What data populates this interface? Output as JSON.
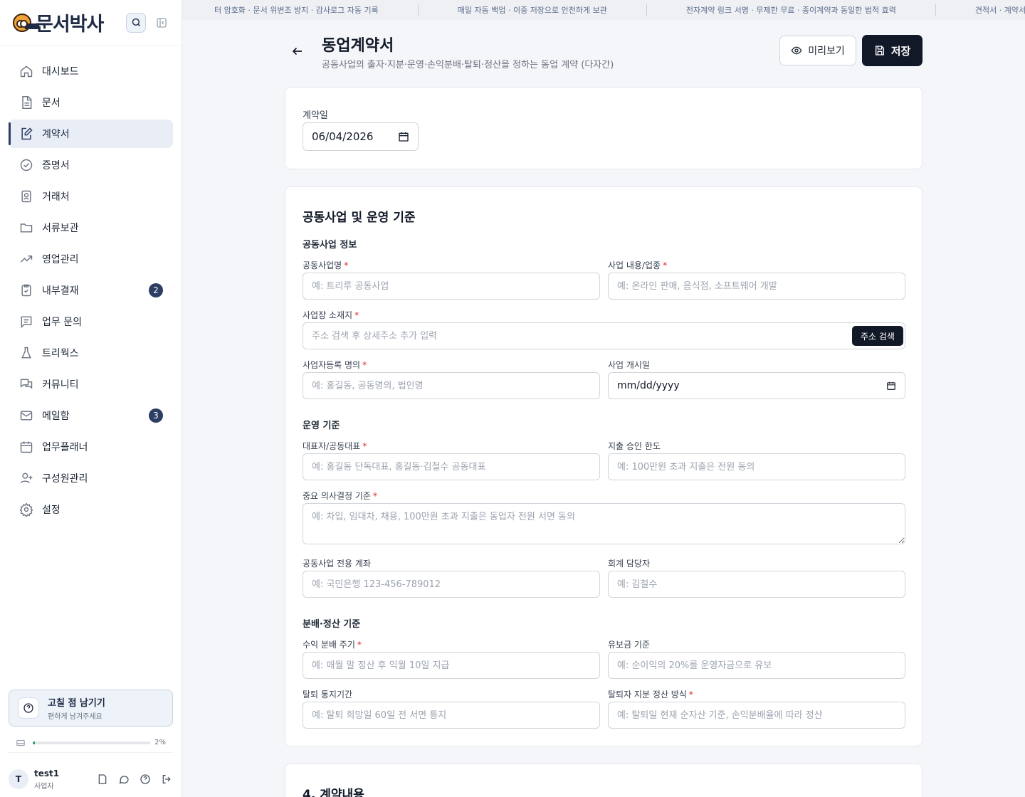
{
  "brand": {
    "name": "문서박사"
  },
  "colors": {
    "accent": "#2c3e63",
    "primary_button": "#111827",
    "required": "#dc2626",
    "storage_fill": "#22a06b"
  },
  "sidebar": {
    "items": [
      {
        "label": "대시보드",
        "icon": "home-icon"
      },
      {
        "label": "문서",
        "icon": "document-icon"
      },
      {
        "label": "계약서",
        "icon": "contract-edit-icon",
        "active": true
      },
      {
        "label": "증명서",
        "icon": "certificate-check-icon"
      },
      {
        "label": "거래처",
        "icon": "contact-card-icon"
      },
      {
        "label": "서류보관",
        "icon": "folder-icon"
      },
      {
        "label": "영업관리",
        "icon": "trend-up-icon"
      },
      {
        "label": "내부결재",
        "icon": "clipboard-check-icon",
        "badge": "2"
      },
      {
        "label": "업무 문의",
        "icon": "message-lines-icon"
      },
      {
        "label": "트리웍스",
        "icon": "flask-icon"
      },
      {
        "label": "커뮤니티",
        "icon": "chat-bubbles-icon"
      },
      {
        "label": "메일함",
        "icon": "mail-icon",
        "badge": "3"
      },
      {
        "label": "업무플래너",
        "icon": "calendar-icon"
      },
      {
        "label": "구성원관리",
        "icon": "user-plus-icon"
      },
      {
        "label": "설정",
        "icon": "gear-icon"
      }
    ],
    "feedback": {
      "title": "고칠 점 남기기",
      "subtitle": "편하게 남겨주세요"
    },
    "storage": {
      "percent_label": "2%",
      "percent": 0.02
    },
    "user": {
      "initial": "T",
      "name": "test1",
      "role": "사업자"
    }
  },
  "ticker": [
    "터 암호화 · 문서 위변조 방지 · 감사로그 자동 기록",
    "매일 자동 백업 · 이중 저장으로 안전하게 보관",
    "전자계약 링크 서명 · 무제한 무료 · 종이계약과 동일한 법적 효력",
    "견적서 · 계약서 · 급"
  ],
  "header": {
    "title": "동업계약서",
    "subtitle": "공동사업의 출자·지분·운영·손익분배·탈퇴·정산을 정하는 동업 계약 (다자간)",
    "preview_label": "미리보기",
    "save_label": "저장"
  },
  "contract_date": {
    "label": "계약일",
    "value": "06/04/2026"
  },
  "section2": {
    "title": "공동사업 및 운영 기준",
    "group1": "공동사업 정보",
    "business_name": {
      "label": "공동사업명",
      "placeholder": "예: 트리루 공동사업"
    },
    "business_type": {
      "label": "사업 내용/업종",
      "placeholder": "예: 온라인 판매, 음식점, 소프트웨어 개발"
    },
    "address": {
      "label": "사업장 소재지",
      "placeholder": "주소 검색 후 상세주소 추가 입력",
      "button": "주소 검색"
    },
    "registrant": {
      "label": "사업자등록 명의",
      "placeholder": "예: 홍길동, 공동명의, 법인명"
    },
    "start_date": {
      "label": "사업 개시일",
      "value": "mm/dd/yyyy"
    },
    "group2": "운영 기준",
    "representative": {
      "label": "대표자/공동대표",
      "placeholder": "예: 홍길동 단독대표, 홍길동·김철수 공동대표"
    },
    "spend_limit": {
      "label": "지출 승인 한도",
      "placeholder": "예: 100만원 초과 지출은 전원 동의"
    },
    "decision": {
      "label": "중요 의사결정 기준",
      "placeholder": "예: 차입, 임대차, 채용, 100만원 초과 지출은 동업자 전원 서면 동의"
    },
    "account": {
      "label": "공동사업 전용 계좌",
      "placeholder": "예: 국민은행 123-456-789012"
    },
    "accountant": {
      "label": "회계 담당자",
      "placeholder": "예: 김철수"
    },
    "group3": "분배·정산 기준",
    "profit_cycle": {
      "label": "수익 분배 주기",
      "placeholder": "예: 매월 말 정산 후 익월 10일 지급"
    },
    "reserve": {
      "label": "유보금 기준",
      "placeholder": "예: 순이익의 20%를 운영자금으로 유보"
    },
    "withdraw_notice": {
      "label": "탈퇴 통지기간",
      "placeholder": "예: 탈퇴 희망일 60일 전 서면 통지"
    },
    "withdraw_settle": {
      "label": "탈퇴자 지분 정산 방식",
      "placeholder": "예: 탈퇴일 현재 순자산 기준, 손익분배율에 따라 정산"
    }
  },
  "section4": {
    "title": "4. 계약내용"
  }
}
